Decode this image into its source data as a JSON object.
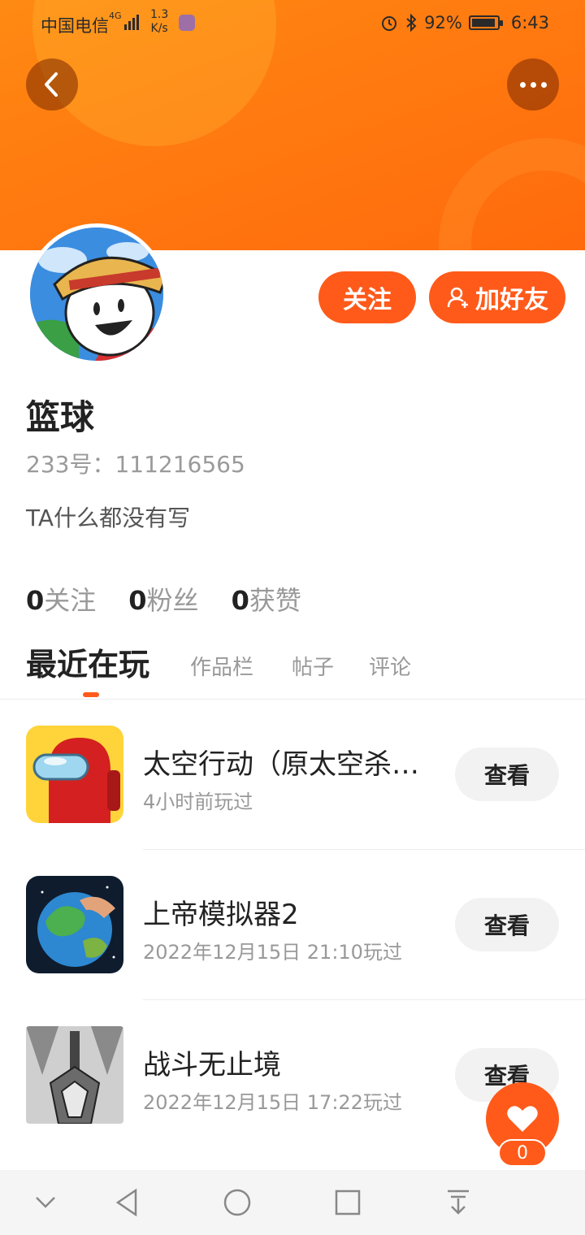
{
  "status_bar": {
    "carrier": "中国电信",
    "network": "4G",
    "speed_value": "1.3",
    "speed_unit": "K/s",
    "battery": "92%",
    "time": "6:43"
  },
  "header": {
    "back_icon": "chevron-left-icon",
    "more_icon": "more-dots-icon",
    "accent_color": "#ff5a1a"
  },
  "profile": {
    "name": "篮球",
    "uid": "233号：111216565",
    "bio": "TA什么都没有写",
    "follow_label": "关注",
    "add_friend_label": "加好友"
  },
  "stats": [
    {
      "value": "0",
      "label": "关注"
    },
    {
      "value": "0",
      "label": "粉丝"
    },
    {
      "value": "0",
      "label": "获赞"
    }
  ],
  "tabs": [
    {
      "label": "最近在玩",
      "active": true
    },
    {
      "label": "作品栏",
      "active": false
    },
    {
      "label": "帖子",
      "active": false
    },
    {
      "label": "评论",
      "active": false
    }
  ],
  "games": [
    {
      "title": "太空行动（原太空杀…",
      "time": "4小时前玩过",
      "button": "查看"
    },
    {
      "title": "上帝模拟器2",
      "time": "2022年12月15日 21:10玩过",
      "button": "查看"
    },
    {
      "title": "战斗无止境",
      "time": "2022年12月15日 17:22玩过",
      "button": "查看"
    }
  ],
  "like_fab": {
    "count": "0",
    "icon": "heart-icon"
  },
  "nav_bar": [
    "collapse-icon",
    "back-triangle-icon",
    "home-circle-icon",
    "recents-square-icon",
    "download-icon"
  ]
}
